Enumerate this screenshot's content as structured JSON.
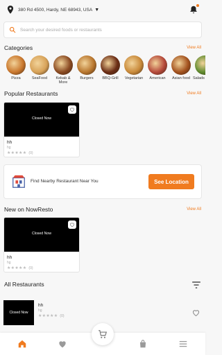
{
  "header": {
    "location": "380 Rd 4500, Hardy, NE 68943, USA",
    "accent_color": "#f07b1f"
  },
  "search": {
    "placeholder": "Search your desired foods or restaurants"
  },
  "categories": {
    "title": "Categories",
    "view_all": "View All",
    "items": [
      {
        "label": "Pizza",
        "icon": "pizza-icon",
        "color": "#c9772d"
      },
      {
        "label": "SeaFood",
        "icon": "seafood-icon",
        "color": "#d7a258"
      },
      {
        "label": "Kebab & More",
        "icon": "kebab-icon",
        "color": "#8a4a22"
      },
      {
        "label": "Burgers",
        "icon": "burger-icon",
        "color": "#b8762e"
      },
      {
        "label": "BBQ-Grill",
        "icon": "bbq-icon",
        "color": "#6b2d15"
      },
      {
        "label": "Vegetarian",
        "icon": "vegetarian-icon",
        "color": "#c98a3a"
      },
      {
        "label": "American",
        "icon": "american-icon",
        "color": "#b5493a"
      },
      {
        "label": "Asian food",
        "icon": "asian-food-icon",
        "color": "#a3521e"
      },
      {
        "label": "Salads Soups",
        "icon": "salad-icon",
        "color": "#5e8a2e"
      }
    ]
  },
  "popular": {
    "title": "Popular Restaurants",
    "view_all": "View All",
    "card": {
      "status": "Closed Now",
      "name": "hh",
      "tag": "hg",
      "stars": "★★★★★",
      "rating_count": "(0)"
    }
  },
  "banner": {
    "text": "Find Nearby Restaurant Near You",
    "button": "See Location"
  },
  "new_on": {
    "title": "New on NowResto",
    "view_all": "View All",
    "card": {
      "status": "Closed Now",
      "name": "hh",
      "tag": "hg",
      "stars": "★★★★★",
      "rating_count": "(0)"
    }
  },
  "all_restaurants": {
    "title": "All Restaurants",
    "item": {
      "status": "Closed Now",
      "name": "hh",
      "tag": "hg",
      "stars": "★★★★★",
      "rating_count": "(0)"
    }
  },
  "bottom_nav": {
    "items": [
      "home-icon",
      "heart-icon",
      "bag-icon",
      "menu-icon"
    ],
    "active_color": "#f07b1f",
    "inactive_color": "#9a9a9a"
  }
}
